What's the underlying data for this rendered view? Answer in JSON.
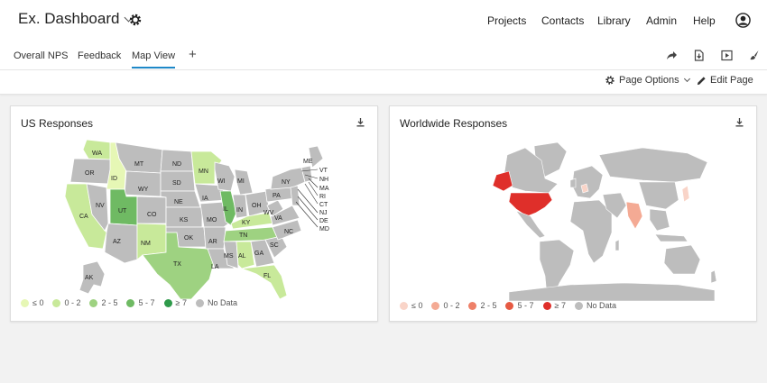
{
  "header": {
    "title": "Ex. Dashboard",
    "nav": [
      "Projects",
      "Contacts",
      "Library",
      "Admin",
      "Help"
    ]
  },
  "tabs": [
    {
      "label": "Overall NPS",
      "active": false
    },
    {
      "label": "Feedback",
      "active": false
    },
    {
      "label": "Map View",
      "active": true
    }
  ],
  "toolbar": {
    "page_options": "Page Options",
    "edit_page": "Edit Page"
  },
  "colors": {
    "accent": "#1e88c8",
    "no_data": "#bdbdbd",
    "green_scale": [
      "#e6f7b5",
      "#c8e99a",
      "#9ed281",
      "#6fba63",
      "#2e9a4a"
    ],
    "red_scale": [
      "#f9d4c8",
      "#f4aa94",
      "#ee8068",
      "#e65a43",
      "#df2f2a"
    ]
  },
  "us_card": {
    "title": "US Responses",
    "states": [
      {
        "abbr": "WA",
        "bin": "0 - 2"
      },
      {
        "abbr": "OR",
        "bin": "No Data"
      },
      {
        "abbr": "CA",
        "bin": "0 - 2"
      },
      {
        "abbr": "ID",
        "bin": "≤ 0"
      },
      {
        "abbr": "NV",
        "bin": "No Data"
      },
      {
        "abbr": "MT",
        "bin": "No Data"
      },
      {
        "abbr": "WY",
        "bin": "No Data"
      },
      {
        "abbr": "UT",
        "bin": "5 - 7"
      },
      {
        "abbr": "AZ",
        "bin": "No Data"
      },
      {
        "abbr": "CO",
        "bin": "No Data"
      },
      {
        "abbr": "NM",
        "bin": "0 - 2"
      },
      {
        "abbr": "ND",
        "bin": "No Data"
      },
      {
        "abbr": "SD",
        "bin": "No Data"
      },
      {
        "abbr": "NE",
        "bin": "No Data"
      },
      {
        "abbr": "KS",
        "bin": "No Data"
      },
      {
        "abbr": "OK",
        "bin": "No Data"
      },
      {
        "abbr": "TX",
        "bin": "2 - 5"
      },
      {
        "abbr": "MN",
        "bin": "0 - 2"
      },
      {
        "abbr": "IA",
        "bin": "No Data"
      },
      {
        "abbr": "MO",
        "bin": "No Data"
      },
      {
        "abbr": "AR",
        "bin": "No Data"
      },
      {
        "abbr": "LA",
        "bin": "No Data"
      },
      {
        "abbr": "WI",
        "bin": "No Data"
      },
      {
        "abbr": "IL",
        "bin": "5 - 7"
      },
      {
        "abbr": "MI",
        "bin": "No Data"
      },
      {
        "abbr": "IN",
        "bin": "No Data"
      },
      {
        "abbr": "OH",
        "bin": "No Data"
      },
      {
        "abbr": "KY",
        "bin": "0 - 2"
      },
      {
        "abbr": "TN",
        "bin": "2 - 5"
      },
      {
        "abbr": "MS",
        "bin": "No Data"
      },
      {
        "abbr": "AL",
        "bin": "0 - 2"
      },
      {
        "abbr": "GA",
        "bin": "No Data"
      },
      {
        "abbr": "FL",
        "bin": "0 - 2"
      },
      {
        "abbr": "SC",
        "bin": "No Data"
      },
      {
        "abbr": "NC",
        "bin": "No Data"
      },
      {
        "abbr": "VA",
        "bin": "No Data"
      },
      {
        "abbr": "WV",
        "bin": "No Data"
      },
      {
        "abbr": "PA",
        "bin": "No Data"
      },
      {
        "abbr": "NY",
        "bin": "No Data"
      },
      {
        "abbr": "ME",
        "bin": "No Data"
      },
      {
        "abbr": "AK",
        "bin": "No Data"
      }
    ],
    "northeast_labels": [
      "VT",
      "NH",
      "MA",
      "RI",
      "CT",
      "NJ",
      "DE",
      "MD"
    ],
    "legend": [
      {
        "label": "≤ 0",
        "color": "#e6f7b5"
      },
      {
        "label": "0 - 2",
        "color": "#c8e99a"
      },
      {
        "label": "2 - 5",
        "color": "#9ed281"
      },
      {
        "label": "5 - 7",
        "color": "#6fba63"
      },
      {
        "label": "≥ 7",
        "color": "#2e9a4a"
      },
      {
        "label": "No Data",
        "color": "#bdbdbd"
      }
    ]
  },
  "world_card": {
    "title": "Worldwide Responses",
    "legend": [
      {
        "label": "≤ 0",
        "color": "#f9d4c8"
      },
      {
        "label": "0 - 2",
        "color": "#f4aa94"
      },
      {
        "label": "2 - 5",
        "color": "#ee8068"
      },
      {
        "label": "5 - 7",
        "color": "#e65a43"
      },
      {
        "label": "≥ 7",
        "color": "#df2f2a"
      },
      {
        "label": "No Data",
        "color": "#bdbdbd"
      }
    ]
  }
}
